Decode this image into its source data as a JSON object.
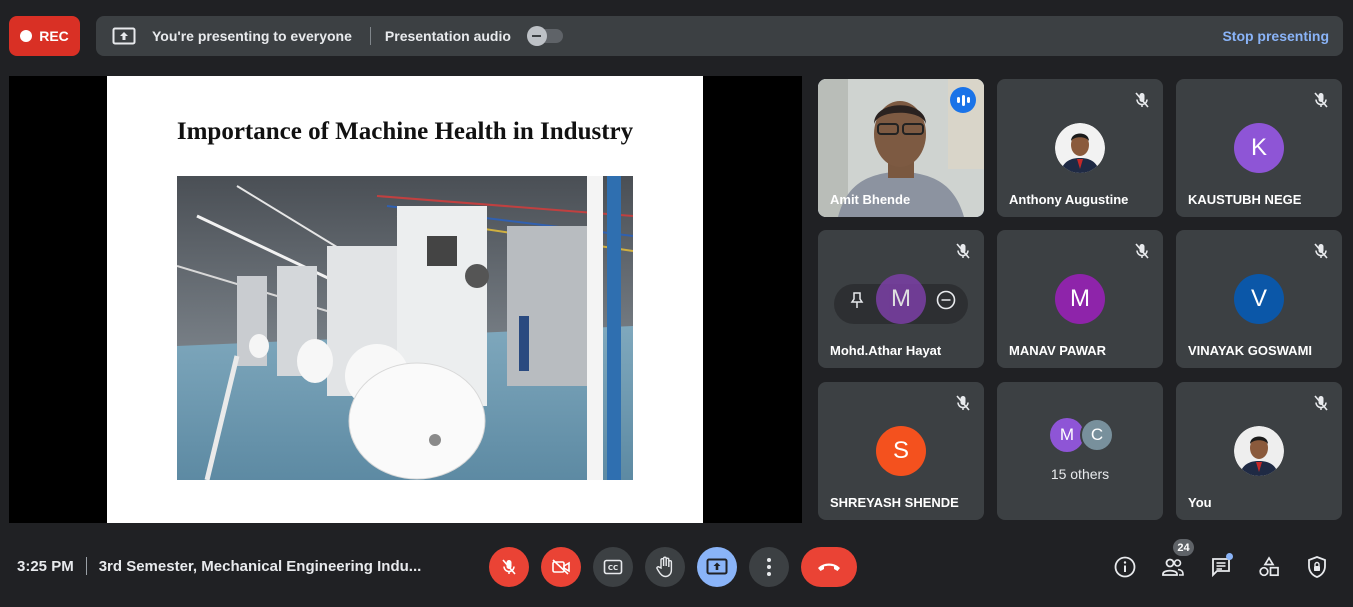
{
  "top_bar": {
    "rec_label": "REC",
    "presenting_text": "You're presenting to everyone",
    "audio_label": "Presentation audio",
    "stop_label": "Stop presenting"
  },
  "slide": {
    "title": "Importance of Machine Health in Industry"
  },
  "participants": [
    {
      "name": "Amit Bhende",
      "speaking": true
    },
    {
      "name": "Anthony Augustine",
      "muted": true
    },
    {
      "name": "KAUSTUBH NEGE",
      "initial": "K",
      "color": "#8e55d6",
      "muted": true
    },
    {
      "name": "Mohd.Athar Hayat",
      "initial": "M",
      "color": "#7b3fa6",
      "muted": true
    },
    {
      "name": "MANAV PAWAR",
      "initial": "M",
      "color": "#8e24aa",
      "muted": true
    },
    {
      "name": "VINAYAK GOSWAMI",
      "initial": "V",
      "color": "#0b57a8",
      "muted": true
    },
    {
      "name": "SHREYASH SHENDE",
      "initial": "S",
      "color": "#f4511e",
      "muted": true
    },
    {
      "name": "15 others",
      "initials": [
        "M",
        "C"
      ],
      "colors": [
        "#8e55d6",
        "#78909c"
      ]
    },
    {
      "name": "You",
      "muted": true
    }
  ],
  "bottom_bar": {
    "time": "3:25 PM",
    "meeting_title": "3rd Semester, Mechanical Engineering Indu...",
    "people_count": "24"
  },
  "colors": {
    "background": "#202124",
    "tile": "#3c4043",
    "danger": "#ea4335",
    "accent": "#8ab4f8"
  }
}
